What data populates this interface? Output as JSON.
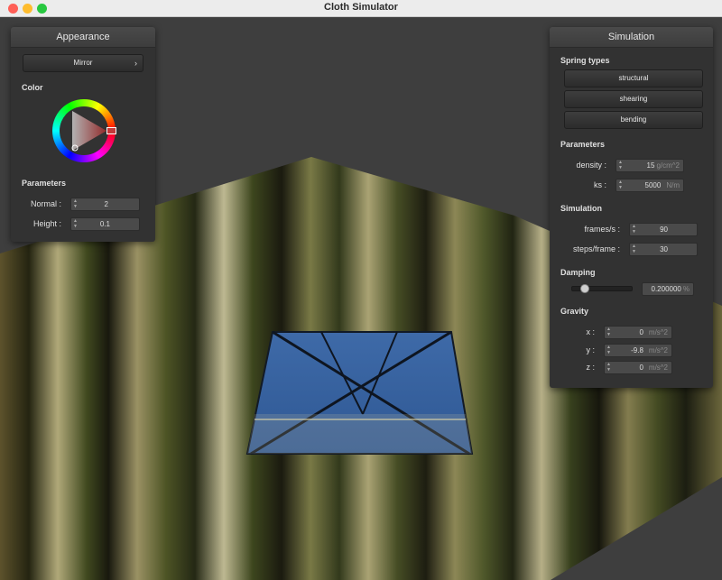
{
  "window": {
    "title": "Cloth Simulator"
  },
  "appearance": {
    "title": "Appearance",
    "shader_value": "Mirror",
    "color_label": "Color",
    "parameters_label": "Parameters",
    "normal_label": "Normal :",
    "normal_value": "2",
    "height_label": "Height :",
    "height_value": "0.1",
    "selected_color": "#c33a3a"
  },
  "simulation": {
    "title": "Simulation",
    "spring_types_label": "Spring types",
    "spring_buttons": [
      "structural",
      "shearing",
      "bending"
    ],
    "parameters_label": "Parameters",
    "density_label": "density :",
    "density_value": "15",
    "density_unit": "g/cm^2",
    "ks_label": "ks :",
    "ks_value": "5000",
    "ks_unit": "N/m",
    "simulation_label": "Simulation",
    "fps_label": "frames/s :",
    "fps_value": "90",
    "steps_label": "steps/frame :",
    "steps_value": "30",
    "damping_label": "Damping",
    "damping_value": "0.200000",
    "damping_unit": "%",
    "gravity_label": "Gravity",
    "gx_label": "x :",
    "gx_value": "0",
    "gx_unit": "m/s^2",
    "gy_label": "y :",
    "gy_value": "-9.8",
    "gy_unit": "m/s^2",
    "gz_label": "z :",
    "gz_value": "0",
    "gz_unit": "m/s^2"
  }
}
